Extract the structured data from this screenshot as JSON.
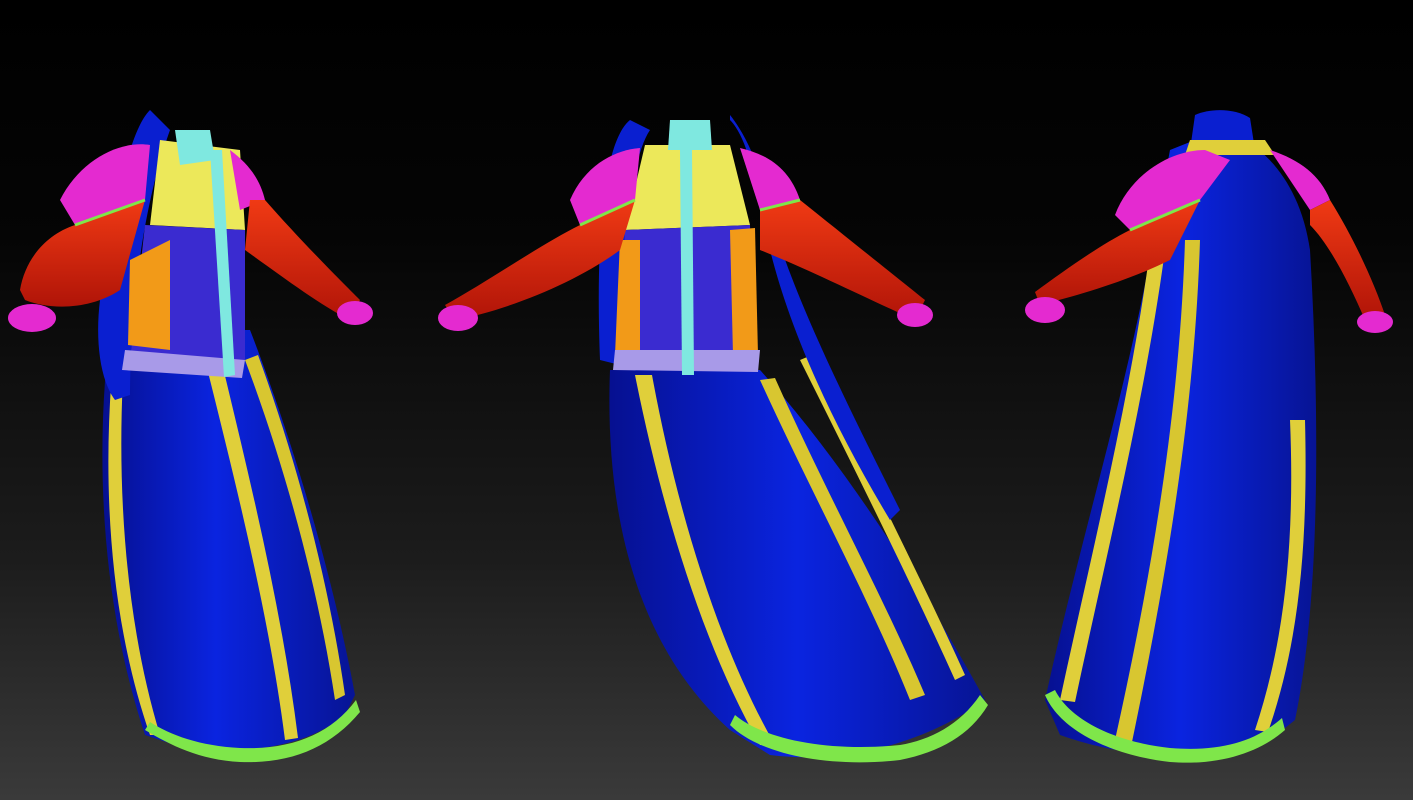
{
  "scene": {
    "background": {
      "top": "#000000",
      "bottom": "#3a3a3a"
    },
    "views": [
      {
        "name": "front-three-quarter-left"
      },
      {
        "name": "front"
      },
      {
        "name": "back-three-quarter"
      }
    ]
  },
  "palette": {
    "coat_blue": "#0a1fd0",
    "coat_blue_dark": "#061090",
    "stripe_yellow": "#e0cf3a",
    "hem_green": "#7fe64a",
    "sleeve_red": "#e0200c",
    "shoulder_magenta": "#e42ad0",
    "vest_yellow": "#ece85a",
    "vest_purple": "#3a2bd0",
    "vest_orange": "#f29a18",
    "zip_cyan": "#7fe8e0",
    "waist_lavender": "#a89ae8"
  }
}
